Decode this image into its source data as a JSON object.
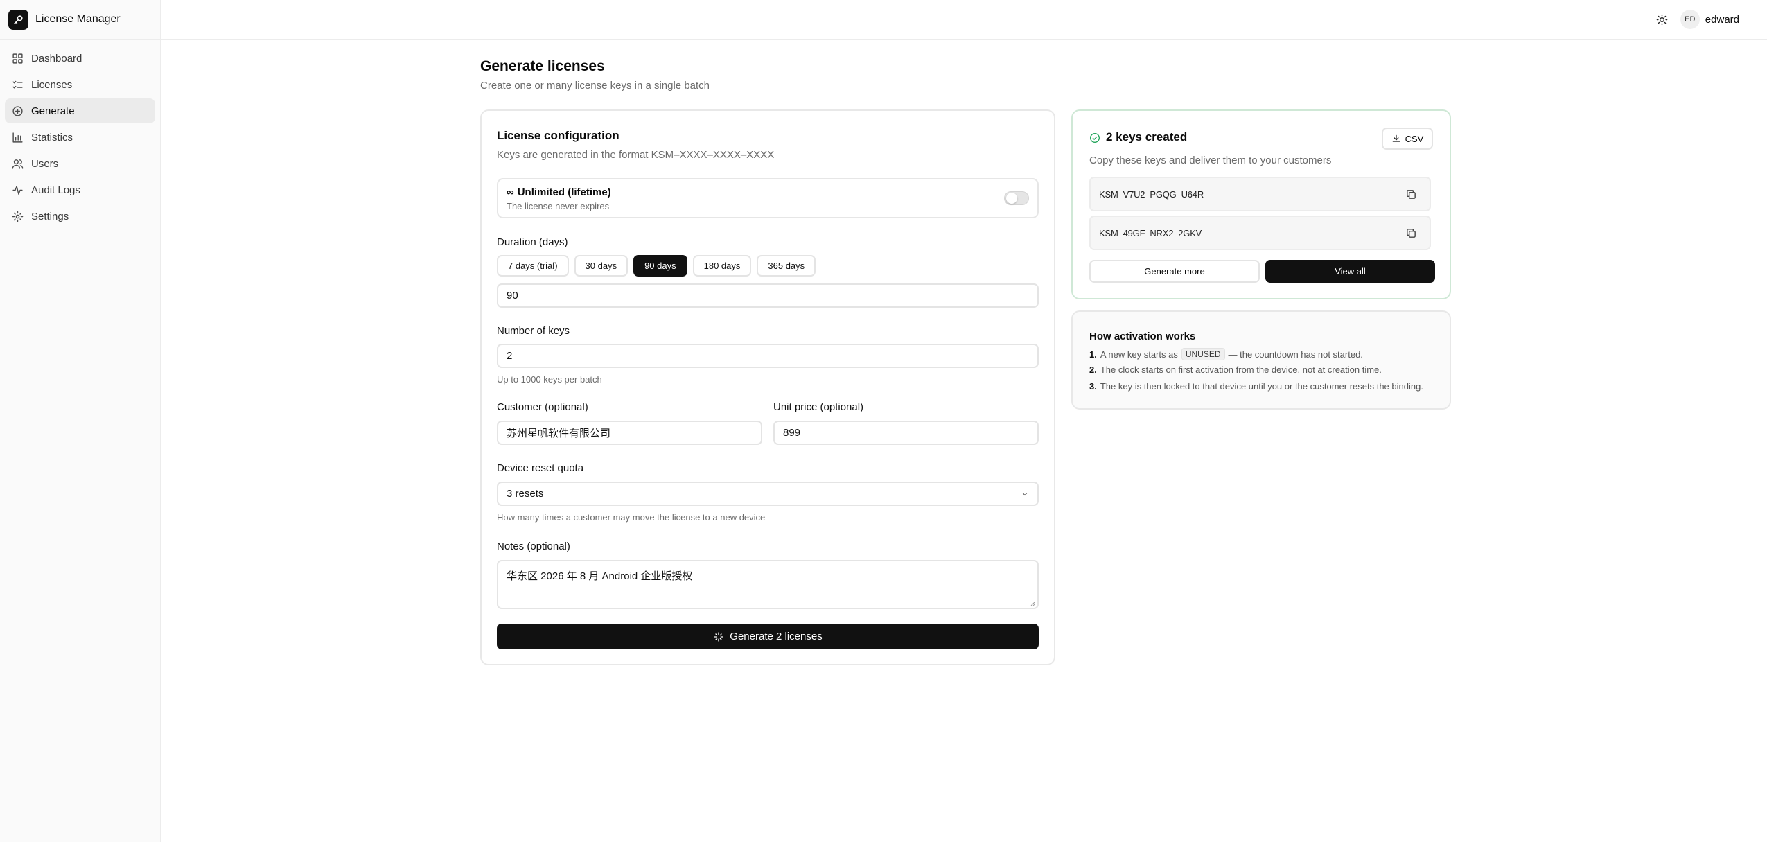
{
  "app": {
    "name": "License Manager"
  },
  "sidebar": {
    "items": [
      {
        "label": "Dashboard"
      },
      {
        "label": "Licenses"
      },
      {
        "label": "Generate"
      },
      {
        "label": "Statistics"
      },
      {
        "label": "Users"
      },
      {
        "label": "Audit Logs"
      },
      {
        "label": "Settings"
      }
    ],
    "active": "Generate"
  },
  "header": {
    "avatar_initials": "ED",
    "username": "edward"
  },
  "page": {
    "title": "Generate licenses",
    "subtitle": "Create one or many license keys in a single batch"
  },
  "config": {
    "title": "License configuration",
    "subtitle": "Keys are generated in the format KSM–XXXX–XXXX–XXXX",
    "lifetime": {
      "title": "Unlimited (lifetime)",
      "subtitle": "The license never expires",
      "enabled": false
    },
    "duration": {
      "label": "Duration (days)",
      "presets": [
        "7 days (trial)",
        "30 days",
        "90 days",
        "180 days",
        "365 days"
      ],
      "selected": "90 days",
      "value": "90"
    },
    "keys": {
      "label": "Number of keys",
      "value": "2",
      "hint": "Up to 1000 keys per batch"
    },
    "customer": {
      "label": "Customer (optional)",
      "value": "苏州星帆软件有限公司"
    },
    "price": {
      "label": "Unit price (optional)",
      "value": "899"
    },
    "reset": {
      "label": "Device reset quota",
      "value": "3 resets",
      "hint": "How many times a customer may move the license to a new device"
    },
    "notes": {
      "label": "Notes (optional)",
      "value": "华东区 2026 年 8 月 Android 企业版授权"
    },
    "submit_label": "Generate 2 licenses"
  },
  "result": {
    "title": "2 keys created",
    "subtitle": "Copy these keys and deliver them to your customers",
    "csv_label": "CSV",
    "keys": [
      "KSM–V7U2–PGQG–U64R",
      "KSM–49GF–NRX2–2GKV"
    ],
    "generate_more_label": "Generate more",
    "view_all_label": "View all",
    "accent_color": "#22a55b"
  },
  "activation": {
    "title": "How activation works",
    "steps": [
      {
        "num": "1.",
        "before": "A new key starts as",
        "code": "UNUSED",
        "after": "— the countdown has not started."
      },
      {
        "num": "2.",
        "text": "The clock starts on first activation from the device, not at creation time."
      },
      {
        "num": "3.",
        "text": "The key is then locked to that device until you or the customer resets the binding."
      }
    ]
  }
}
